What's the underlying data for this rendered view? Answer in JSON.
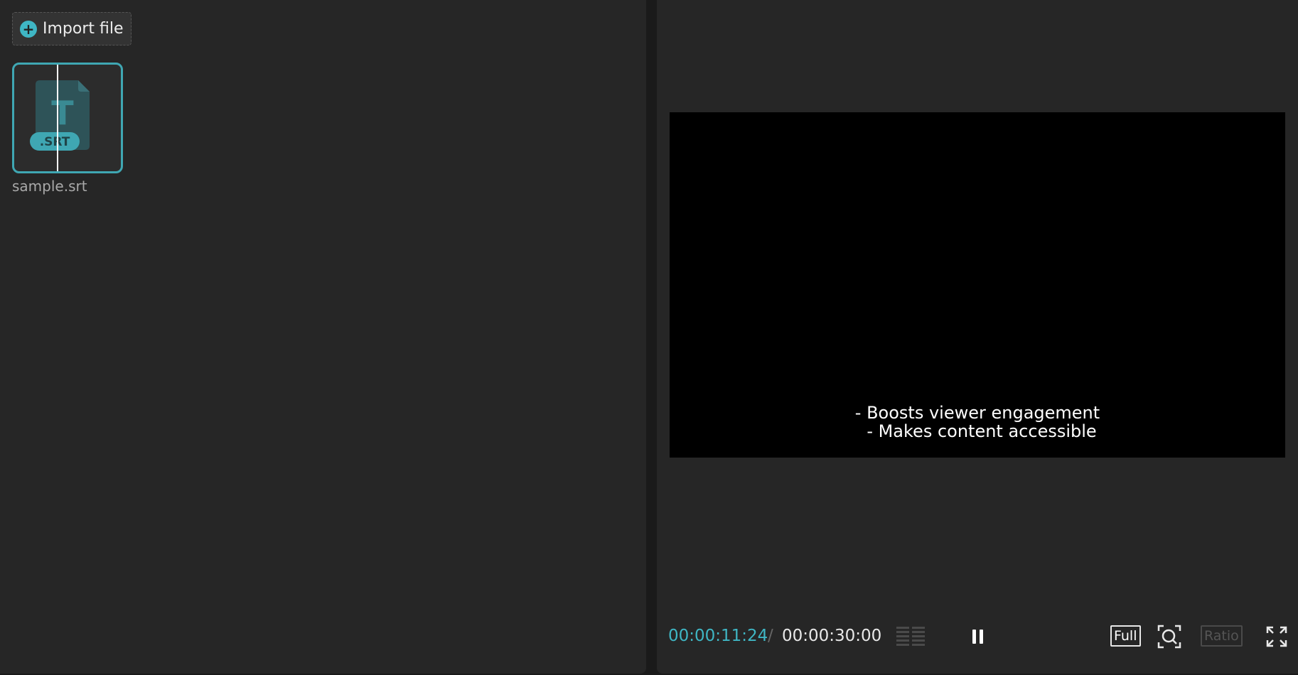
{
  "media": {
    "import_label": "Import file",
    "items": [
      {
        "name": "sample.srt",
        "badge": ".SRT",
        "type_glyph": "T"
      }
    ]
  },
  "player": {
    "subtitle_lines": [
      "- Boosts viewer engagement",
      "- Makes content accessible"
    ],
    "time_current": "00:00:11:24",
    "time_separator": "/",
    "time_total": "00:00:30:00",
    "full_label": "Full",
    "ratio_label": "Ratio"
  },
  "colors": {
    "accent": "#3fb6c4",
    "panel_bg": "#262626",
    "canvas_bg": "#000000"
  },
  "icons": {
    "import": "plus-circle-icon",
    "waveform": "waveform-icon",
    "pause": "pause-icon",
    "zoom": "zoom-frame-icon",
    "fullscreen": "fullscreen-icon"
  }
}
